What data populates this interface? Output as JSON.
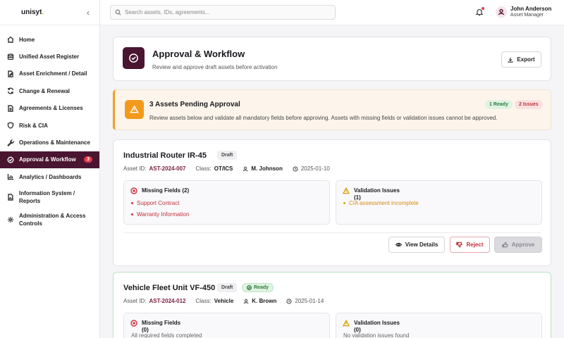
{
  "brand": {
    "name": "unisyt",
    "dot": "."
  },
  "sidebar": {
    "items": [
      {
        "label": "Home",
        "icon": "home-icon"
      },
      {
        "label": "Unified Asset Register",
        "icon": "database-icon"
      },
      {
        "label": "Asset Enrichment / Detail",
        "icon": "file-edit-icon"
      },
      {
        "label": "Change & Renewal",
        "icon": "refresh-icon"
      },
      {
        "label": "Agreements & Licenses",
        "icon": "document-icon"
      },
      {
        "label": "Risk & CIA",
        "icon": "shield-icon"
      },
      {
        "label": "Operations & Maintenance",
        "icon": "wrench-icon"
      },
      {
        "label": "Approval & Workflow",
        "icon": "check-circle-icon",
        "badge": "3",
        "active": true
      },
      {
        "label": "Analytics / Dashboards",
        "icon": "bar-chart-icon"
      },
      {
        "label": "Information System / Reports",
        "icon": "report-icon"
      },
      {
        "label": "Administration & Access Controls",
        "icon": "gear-icon"
      }
    ]
  },
  "topbar": {
    "search_placeholder": "Search assets, IDs, agreements...",
    "user_name": "John Anderson",
    "user_role": "Asset Manager"
  },
  "page": {
    "title": "Approval & Workflow",
    "subtitle": "Review and approve draft assets before activation",
    "export_label": "Export"
  },
  "alert": {
    "title": "3 Assets Pending Approval",
    "text": "Review assets below and validate all mandatory fields before approving. Assets with missing fields or validation issues cannot be approved.",
    "ready_pill": "1 Ready",
    "issues_pill": "2 Issues"
  },
  "assets": [
    {
      "name": "Industrial Router IR-45",
      "status_tag": "Draft",
      "asset_id_label": "Asset ID:",
      "asset_id": "AST-2024-007",
      "class_label": "Class:",
      "class": "OT/ICS",
      "owner": "M. Johnson",
      "date": "2025-01-10",
      "missing_title": "Missing Fields (2)",
      "missing_items": [
        "Support Contract",
        "Warranty Information"
      ],
      "validation_title_1": "Validation Issues",
      "validation_title_2": "(1)",
      "validation_items": [
        "CIA assessment incomplete"
      ],
      "view_label": "View Details",
      "reject_label": "Reject",
      "approve_label": "Approve"
    },
    {
      "name": "Vehicle Fleet Unit VF-450",
      "status_tag": "Draft",
      "ready_tag": "Ready",
      "asset_id_label": "Asset ID:",
      "asset_id": "AST-2024-012",
      "class_label": "Class:",
      "class": "Vehicle",
      "owner": "K. Brown",
      "date": "2025-01-14",
      "missing_title_1": "Missing Fields",
      "missing_title_2": "(0)",
      "missing_note": "All required fields completed",
      "validation_title_1": "Validation Issues",
      "validation_title_2": "(0)",
      "validation_note": "No validation issues found"
    }
  ]
}
